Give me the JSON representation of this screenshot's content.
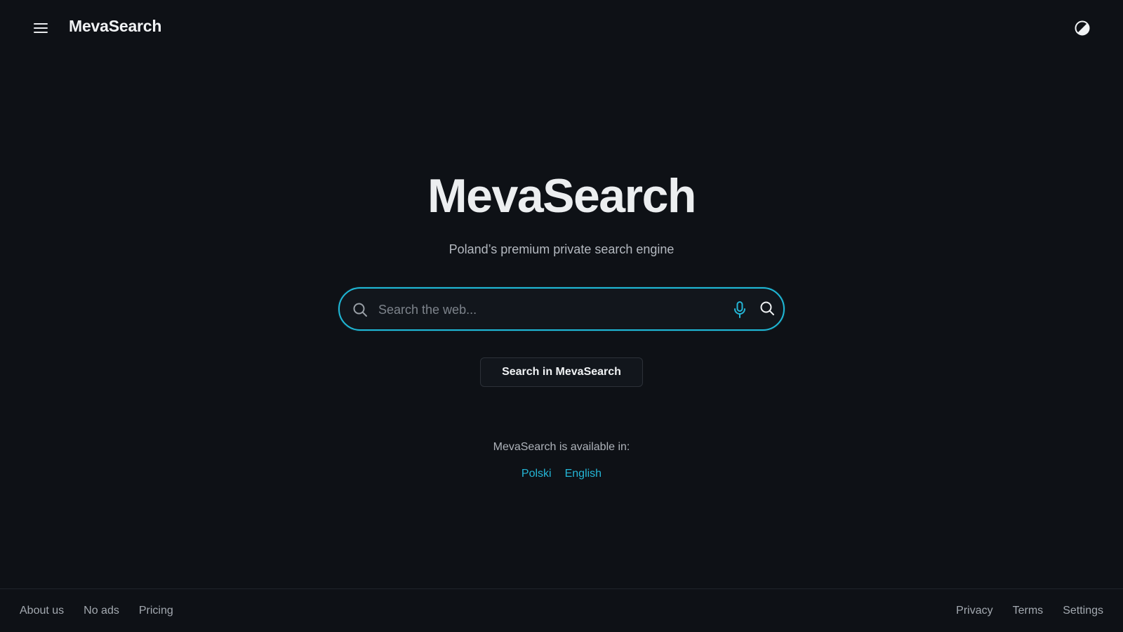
{
  "header": {
    "brand": "MevaSearch",
    "menu_icon": "hamburger-menu-icon",
    "theme_icon": "contrast-theme-icon"
  },
  "hero": {
    "title": "MevaSearch",
    "tagline": "Poland’s premium private search engine"
  },
  "search": {
    "placeholder": "Search the web...",
    "value": "",
    "lead_icon": "search-icon",
    "mic_icon": "microphone-icon",
    "submit_icon": "search-icon",
    "button_label": "Search in MevaSearch"
  },
  "availability": {
    "label": "MevaSearch is available in:",
    "languages": [
      "Polski",
      "English"
    ]
  },
  "footer": {
    "left_links": [
      "About us",
      "No ads",
      "Pricing"
    ],
    "right_links": [
      "Privacy",
      "Terms",
      "Settings"
    ]
  },
  "colors": {
    "background": "#0e1116",
    "accent": "#1fb8d6",
    "link": "#24b6d6",
    "text": "#e8eaed"
  }
}
